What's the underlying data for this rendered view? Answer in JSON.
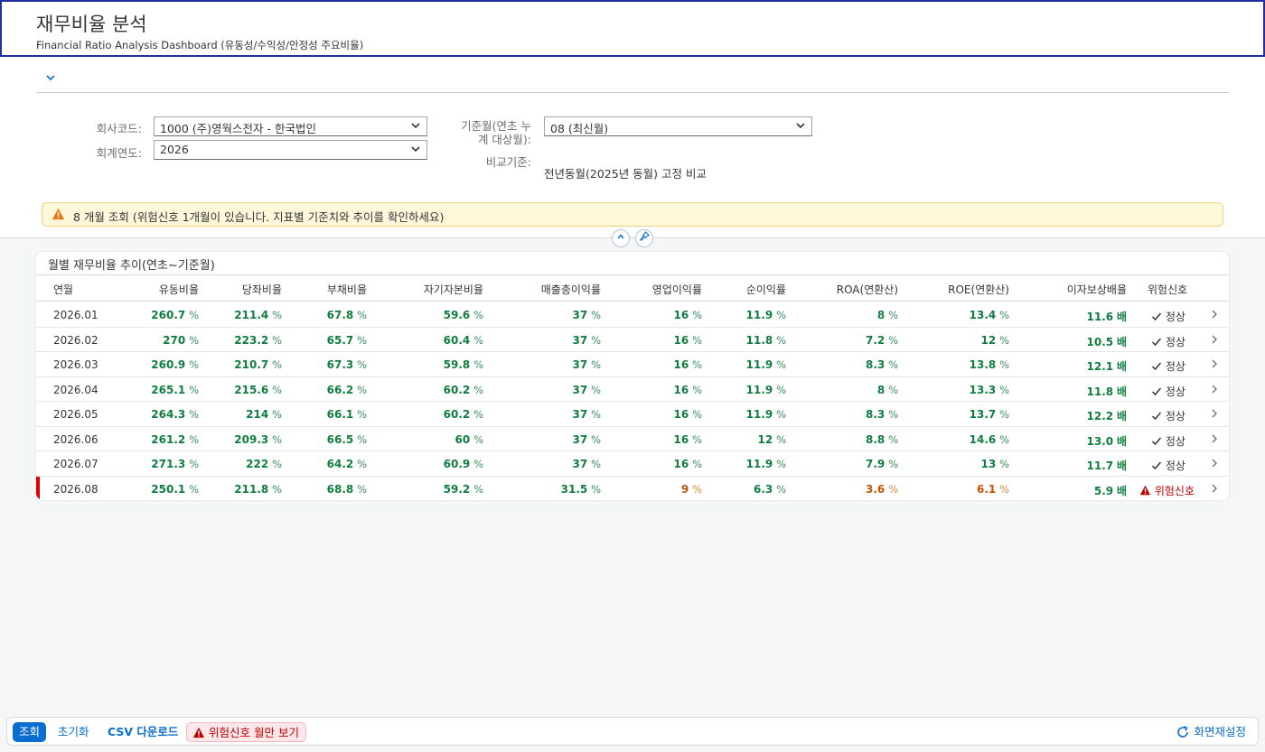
{
  "header": {
    "title": "재무비율 분석",
    "subtitle": "Financial Ratio Analysis Dashboard (유동성/수익성/안정성 주요비율)"
  },
  "filters": {
    "company_label": "회사코드:",
    "company_value": "1000 (주)영웍스전자 - 한국법인",
    "year_label": "회계연도:",
    "year_value": "2026",
    "month_label_line1": "기준월(연초 누",
    "month_label_line2": "계 대상월):",
    "month_value": "08 (최신월)",
    "compare_label": "비교기준:",
    "compare_value": "전년동월(2025년 동월) 고정 비교"
  },
  "message": "8 개월 조회 (위험신호 1개월이 있습니다. 지표별 기준치와 추이를 확인하세요)",
  "table": {
    "title": "월별 재무비율 추이(연초~기준월)",
    "columns": [
      "연월",
      "유동비율",
      "당좌비율",
      "부채비율",
      "자기자본비율",
      "매출총이익률",
      "영업이익률",
      "순이익률",
      "ROA(연환산)",
      "ROE(연환산)",
      "이자보상배율",
      "위험신호"
    ],
    "unit_pct": "%",
    "unit_times": "배",
    "rows": [
      {
        "month": "2026.01",
        "current": "260.7",
        "quick": "211.4",
        "debt": "67.8",
        "equity": "59.6",
        "gross": "37",
        "op": "16",
        "net": "11.9",
        "roa": "8",
        "roe": "13.4",
        "icr": "11.6",
        "status": "정상"
      },
      {
        "month": "2026.02",
        "current": "270",
        "quick": "223.2",
        "debt": "65.7",
        "equity": "60.4",
        "gross": "37",
        "op": "16",
        "net": "11.8",
        "roa": "7.2",
        "roe": "12",
        "icr": "10.5",
        "status": "정상"
      },
      {
        "month": "2026.03",
        "current": "260.9",
        "quick": "210.7",
        "debt": "67.3",
        "equity": "59.8",
        "gross": "37",
        "op": "16",
        "net": "11.9",
        "roa": "8.3",
        "roe": "13.8",
        "icr": "12.1",
        "status": "정상"
      },
      {
        "month": "2026.04",
        "current": "265.1",
        "quick": "215.6",
        "debt": "66.2",
        "equity": "60.2",
        "gross": "37",
        "op": "16",
        "net": "11.9",
        "roa": "8",
        "roe": "13.3",
        "icr": "11.8",
        "status": "정상"
      },
      {
        "month": "2026.05",
        "current": "264.3",
        "quick": "214",
        "debt": "66.1",
        "equity": "60.2",
        "gross": "37",
        "op": "16",
        "net": "11.9",
        "roa": "8.3",
        "roe": "13.7",
        "icr": "12.2",
        "status": "정상"
      },
      {
        "month": "2026.06",
        "current": "261.2",
        "quick": "209.3",
        "debt": "66.5",
        "equity": "60",
        "gross": "37",
        "op": "16",
        "net": "12",
        "roa": "8.8",
        "roe": "14.6",
        "icr": "13.0",
        "status": "정상"
      },
      {
        "month": "2026.07",
        "current": "271.3",
        "quick": "222",
        "debt": "64.2",
        "equity": "60.9",
        "gross": "37",
        "op": "16",
        "net": "11.9",
        "roa": "7.9",
        "roe": "13",
        "icr": "11.7",
        "status": "정상"
      },
      {
        "month": "2026.08",
        "current": "250.1",
        "quick": "211.8",
        "debt": "68.8",
        "equity": "59.2",
        "gross": "31.5",
        "op": "9",
        "net": "6.3",
        "roa": "3.6",
        "roe": "6.1",
        "icr": "5.9",
        "status": "위험신호"
      }
    ]
  },
  "footer": {
    "search": "조회",
    "reset": "초기화",
    "csv": "CSV 다운로드",
    "risk_only": "위험신호 월만 보기",
    "restore": "화면재설정"
  },
  "colors": {
    "accent": "#0a6ed1",
    "positive": "#107e3e",
    "critical": "#c35500",
    "negative": "#bb0000",
    "header_border": "#2030a0"
  }
}
